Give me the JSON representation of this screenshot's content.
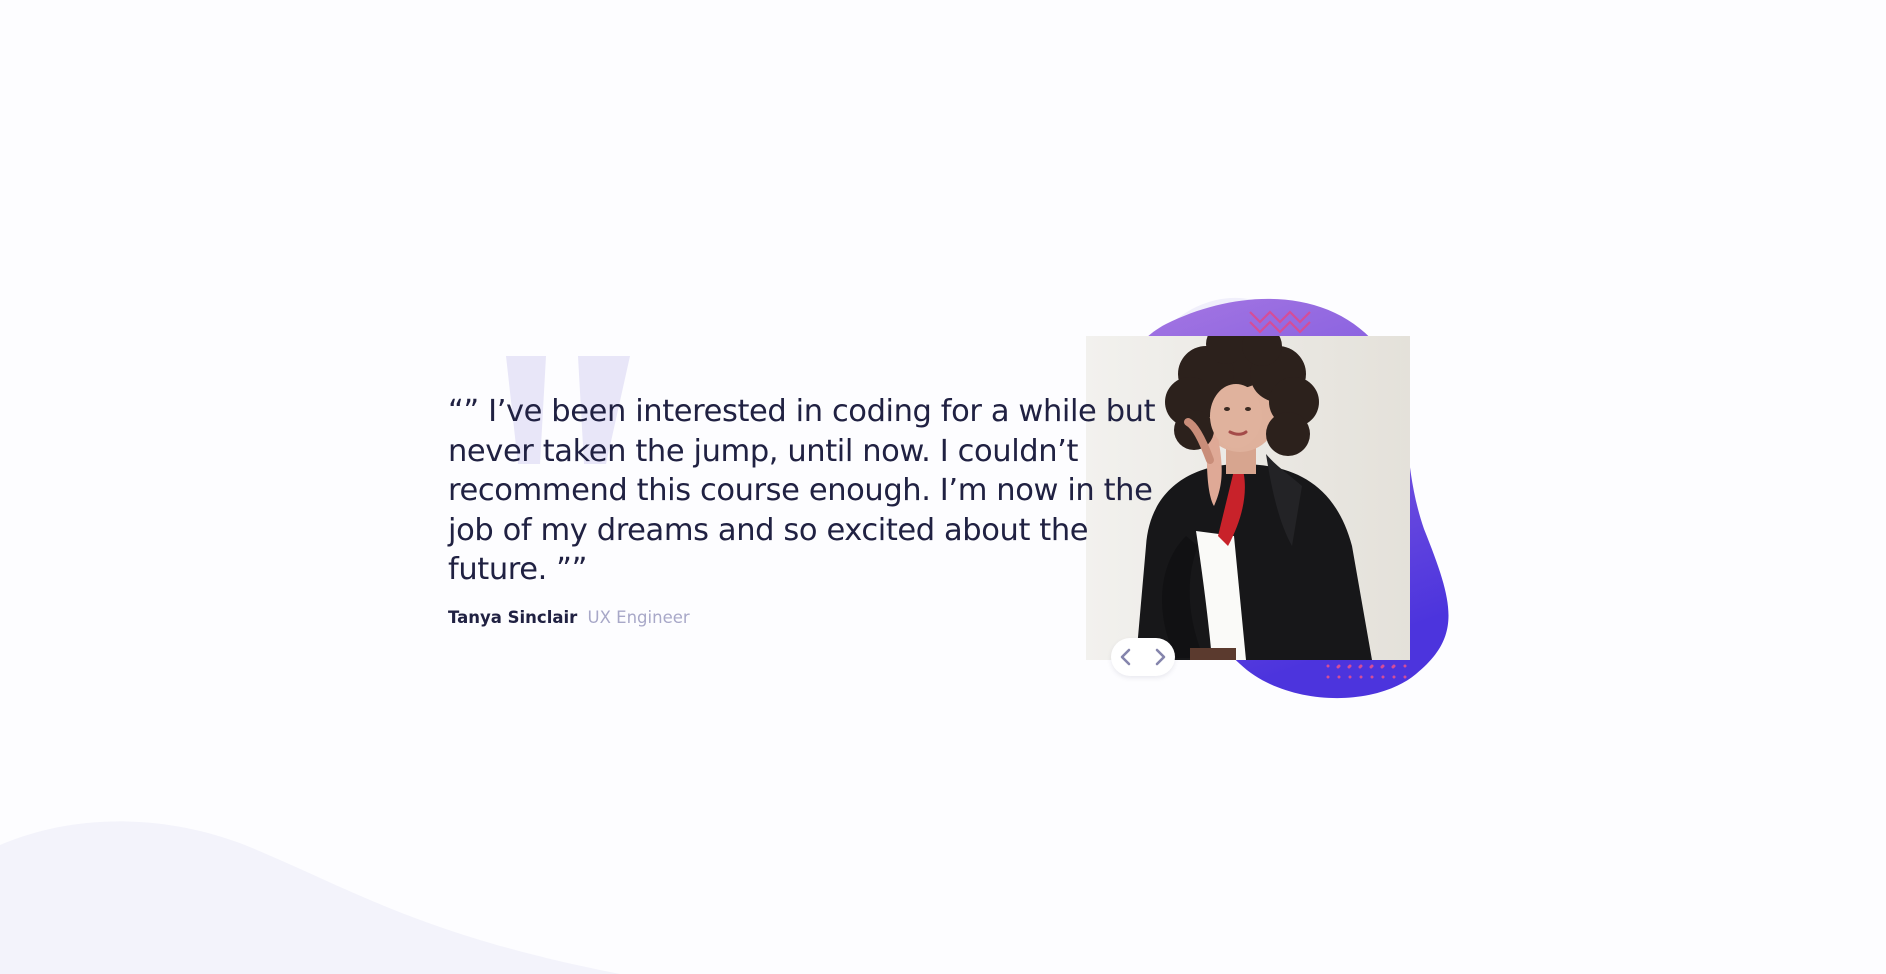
{
  "testimonial": {
    "quote": "“” I’ve been interested in coding for a while but never taken the jump, until now. I couldn’t recommend this course enough. I’m now in the job of my dreams and so excited about the future. ””",
    "author_name": "Tanya Sinclair",
    "author_role": "UX Engineer"
  },
  "navigation": {
    "prev_icon": "chevron-left-icon",
    "next_icon": "chevron-right-icon"
  },
  "colors": {
    "page_background": "#fdfdff",
    "wave_background": "#f3f3fb",
    "heading_text": "#202142",
    "muted_text": "#a8a8c8",
    "blob_gradient_start": "#9a6bdf",
    "blob_gradient_end": "#4c34dd",
    "accent_pink": "#d54d98",
    "quote_mark": "#e8e6f8"
  }
}
